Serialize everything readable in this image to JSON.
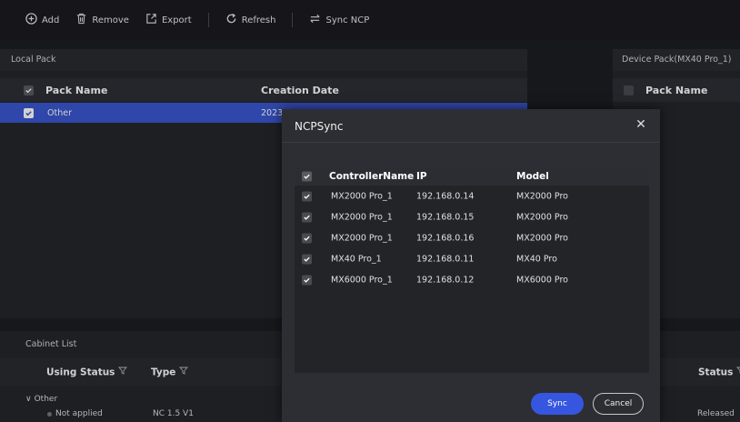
{
  "toolbar": {
    "add": "Add",
    "remove": "Remove",
    "export": "Export",
    "refresh": "Refresh",
    "sync_ncp": "Sync NCP"
  },
  "local_pack": {
    "title": "Local Pack",
    "col_name": "Pack Name",
    "col_date": "Creation Date",
    "rows": [
      {
        "name": "Other",
        "date": "2023"
      }
    ]
  },
  "device_pack": {
    "title": "Device Pack(MX40 Pro_1)",
    "col_name": "Pack Name"
  },
  "cabinet_list": {
    "title": "Cabinet List",
    "col_using_status": "Using Status",
    "col_type": "Type",
    "col_status": "Status",
    "group": "Other",
    "row": {
      "using_status": "Not applied",
      "type": "NC 1.5 V1",
      "status": "Released"
    }
  },
  "dialog": {
    "title": "NCPSync",
    "columns": {
      "controller": "ControllerName",
      "ip": "IP",
      "model": "Model"
    },
    "rows": [
      {
        "controller": "MX2000 Pro_1",
        "ip": "192.168.0.14",
        "model": "MX2000 Pro"
      },
      {
        "controller": "MX2000 Pro_1",
        "ip": "192.168.0.15",
        "model": "MX2000 Pro"
      },
      {
        "controller": "MX2000 Pro_1",
        "ip": "192.168.0.16",
        "model": "MX2000 Pro"
      },
      {
        "controller": "MX40 Pro_1",
        "ip": "192.168.0.11",
        "model": "MX40 Pro"
      },
      {
        "controller": "MX6000 Pro_1",
        "ip": "192.168.0.12",
        "model": "MX6000 Pro"
      }
    ],
    "sync_label": "Sync",
    "cancel_label": "Cancel"
  },
  "colors": {
    "accent": "#3656e0",
    "selection": "#3a56d0",
    "background": "#1d1e22",
    "panel": "#25262b"
  },
  "icons": [
    "add-icon",
    "trash-icon",
    "export-icon",
    "refresh-icon",
    "sync-icon",
    "close-icon",
    "filter-icon",
    "check-icon",
    "chevron-down-icon"
  ]
}
